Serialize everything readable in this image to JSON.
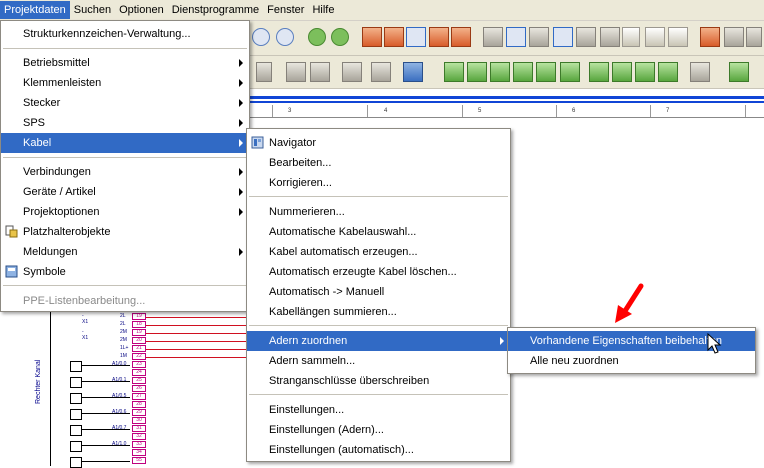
{
  "menubar": {
    "items": [
      "Projektdaten",
      "Suchen",
      "Optionen",
      "Dienstprogramme",
      "Fenster",
      "Hilfe"
    ]
  },
  "menu1": {
    "items": [
      {
        "label": "Strukturkennzeichen-Verwaltung...",
        "submenu": false
      },
      {
        "label": "Betriebsmittel",
        "submenu": true
      },
      {
        "label": "Klemmenleisten",
        "submenu": true
      },
      {
        "label": "Stecker",
        "submenu": true
      },
      {
        "label": "SPS",
        "submenu": true
      },
      {
        "label": "Kabel",
        "submenu": true
      },
      {
        "label": "Verbindungen",
        "submenu": true
      },
      {
        "label": "Geräte / Artikel",
        "submenu": true
      },
      {
        "label": "Projektoptionen",
        "submenu": true
      },
      {
        "label": "Platzhalterobjekte",
        "submenu": false
      },
      {
        "label": "Meldungen",
        "submenu": true
      },
      {
        "label": "Symbole",
        "submenu": false
      },
      {
        "label": "PPE-Listenbearbeitung...",
        "submenu": false
      }
    ]
  },
  "menu2": {
    "items": [
      {
        "label": "Navigator"
      },
      {
        "label": "Bearbeiten..."
      },
      {
        "label": "Korrigieren..."
      },
      {
        "label": "Nummerieren..."
      },
      {
        "label": "Automatische Kabelauswahl..."
      },
      {
        "label": "Kabel automatisch erzeugen..."
      },
      {
        "label": "Automatisch erzeugte Kabel löschen..."
      },
      {
        "label": "Automatisch -> Manuell"
      },
      {
        "label": "Kabellängen summieren..."
      },
      {
        "label": "Adern zuordnen"
      },
      {
        "label": "Adern sammeln..."
      },
      {
        "label": "Stranganschlüsse überschreiben"
      },
      {
        "label": "Einstellungen..."
      },
      {
        "label": "Einstellungen (Adern)..."
      },
      {
        "label": "Einstellungen (automatisch)..."
      }
    ]
  },
  "menu3": {
    "items": [
      {
        "label": "Vorhandene Eigenschaften beibehalten"
      },
      {
        "label": "Alle neu zuordnen"
      }
    ]
  },
  "canvas": {
    "ruler_ticks": [
      "3",
      "4",
      "5",
      "6",
      "7"
    ],
    "cable_label": "Rechter Kanal",
    "rows": [
      {
        "left": "-X1",
        "mid": "2L",
        "term": "19"
      },
      {
        "left": "",
        "mid": "2L",
        "term": "18"
      },
      {
        "left": "-X1",
        "mid": "2M",
        "term": "19"
      },
      {
        "left": "",
        "mid": "2M",
        "term": "20"
      },
      {
        "left": "",
        "mid": "1L+",
        "term": "21"
      },
      {
        "left": "",
        "mid": "1M",
        "term": "22"
      },
      {
        "left": "",
        "mid": "A1/0.0",
        "term": "23"
      },
      {
        "left": "",
        "mid": "",
        "term": "24"
      },
      {
        "left": "",
        "mid": "A1/0.1",
        "term": "25"
      },
      {
        "left": "",
        "mid": "",
        "term": "26"
      },
      {
        "left": "",
        "mid": "A1/0.5",
        "term": "27"
      },
      {
        "left": "",
        "mid": "",
        "term": "28"
      },
      {
        "left": "",
        "mid": "A1/0.6",
        "term": "29"
      },
      {
        "left": "",
        "mid": "",
        "term": "30"
      },
      {
        "left": "",
        "mid": "A1/0.7",
        "term": "31"
      },
      {
        "left": "",
        "mid": "",
        "term": "32"
      },
      {
        "left": "",
        "mid": "A1/1.0",
        "term": "33"
      },
      {
        "left": "",
        "mid": "",
        "term": "34"
      },
      {
        "left": "",
        "mid": "",
        "term": "55"
      }
    ]
  },
  "colors": {
    "highlight": "#316ac5",
    "menubar": "#ece9d8",
    "arrow": "#ff0000"
  }
}
